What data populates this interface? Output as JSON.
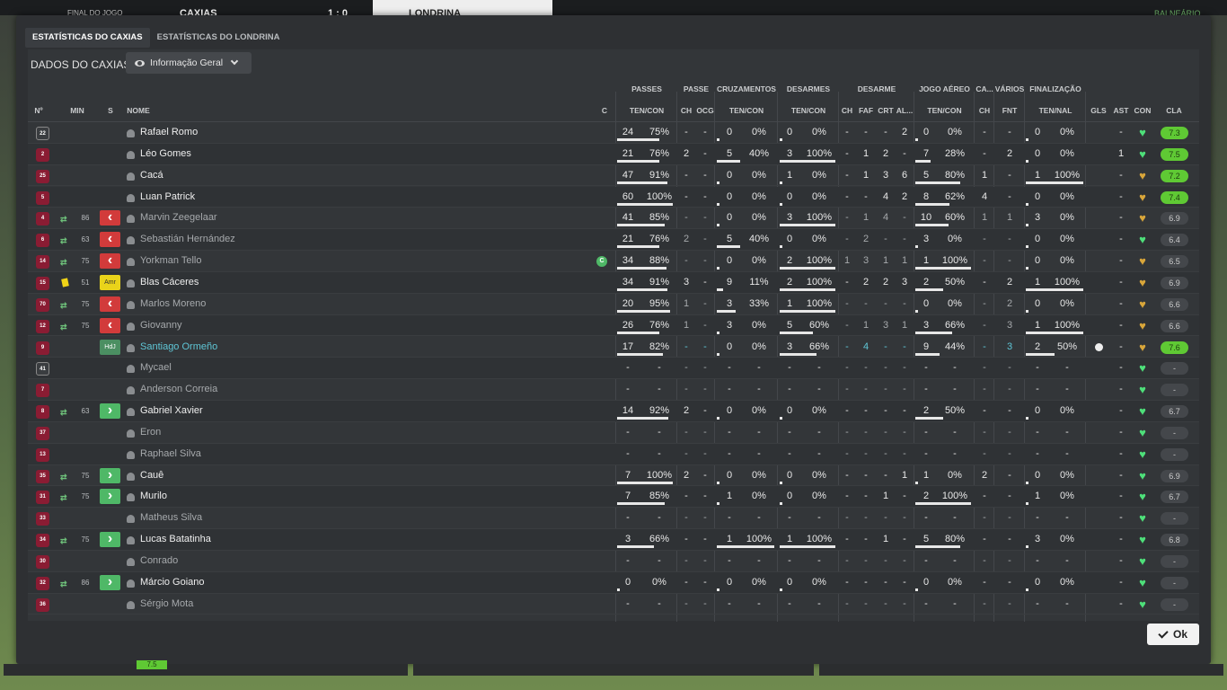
{
  "topbar": {
    "status": "FINAL DO JOGO",
    "home_team": "CAXIAS",
    "score": "1 : 0",
    "away_team": "LONDRINA",
    "right_label": "BALNEÁRIO"
  },
  "tabs": [
    {
      "label": "ESTATÍSTICAS DO CAXIAS",
      "active": true
    },
    {
      "label": "ESTATÍSTICAS DO LONDRINA",
      "active": false
    }
  ],
  "panel": {
    "title": "DADOS DO CAXIAS",
    "view_selector": "Informação Geral"
  },
  "group_headers": [
    "PASSES",
    "PASSE",
    "CRUZAMENTOS",
    "DESARMES",
    "DESARME",
    "JOGO AÉREO",
    "CA...",
    "VÁRIOS",
    "FINALIZAÇÃO"
  ],
  "columns": {
    "num": "Nº",
    "min": "MIN",
    "s": "S",
    "nome": "NOME",
    "c": "C",
    "passes": "TEN/CON",
    "passe_ch": "CH",
    "passe_ocg": "OCG",
    "cruz": "TEN/CON",
    "desarmes": "TEN/CON",
    "des_ch": "CH",
    "des_faf": "FAF",
    "des_crt": "CRT",
    "des_al": "AL...",
    "aereo": "TEN/CON",
    "ca_ch": "CH",
    "fnt": "FNT",
    "final": "TEN/NAL",
    "gls": "GLS",
    "ast": "AST",
    "con": "CON",
    "cla": "CLA"
  },
  "colors": {
    "accent_green": "#5fc934",
    "sub_out": "#d23b3b",
    "sub_in": "#4fb867",
    "highlight_name": "#5fc6d6",
    "shirt": "#8a1c33"
  },
  "players": [
    {
      "num": "22",
      "gk": true,
      "min": "",
      "s": "",
      "nome": "Rafael Romo",
      "dim": false,
      "c": "",
      "pt": "24",
      "pp": "75%",
      "pch": "-",
      "pocg": "-",
      "ct": "0",
      "cp": "0%",
      "dt": "0",
      "dp": "0%",
      "dch": "-",
      "faf": "-",
      "crt": "-",
      "al": "2",
      "at": "0",
      "ap": "0%",
      "cach": "-",
      "fnt": "-",
      "ft": "0",
      "fp": "0%",
      "gls": "",
      "ast": "-",
      "con": "green",
      "cla": "7.3",
      "cla_g": true
    },
    {
      "num": "2",
      "min": "",
      "s": "",
      "nome": "Léo Gomes",
      "c": "",
      "pt": "21",
      "pp": "76%",
      "pch": "2",
      "pocg": "-",
      "ct": "5",
      "cp": "40%",
      "dt": "3",
      "dp": "100%",
      "dch": "-",
      "faf": "1",
      "crt": "2",
      "al": "-",
      "at": "7",
      "ap": "28%",
      "cach": "-",
      "fnt": "2",
      "ft": "0",
      "fp": "0%",
      "gls": "",
      "ast": "1",
      "con": "green",
      "cla": "7.5",
      "cla_g": true
    },
    {
      "num": "25",
      "min": "",
      "s": "",
      "nome": "Cacá",
      "c": "",
      "pt": "47",
      "pp": "91%",
      "pch": "-",
      "pocg": "-",
      "ct": "0",
      "cp": "0%",
      "dt": "1",
      "dp": "0%",
      "dch": "-",
      "faf": "1",
      "crt": "3",
      "al": "6",
      "at": "5",
      "ap": "80%",
      "cach": "1",
      "fnt": "-",
      "ft": "1",
      "fp": "100%",
      "gls": "",
      "ast": "-",
      "con": "gold",
      "cla": "7.2",
      "cla_g": true
    },
    {
      "num": "5",
      "min": "",
      "s": "",
      "nome": "Luan Patrick",
      "c": "",
      "pt": "60",
      "pp": "100%",
      "pch": "-",
      "pocg": "-",
      "ct": "0",
      "cp": "0%",
      "dt": "0",
      "dp": "0%",
      "dch": "-",
      "faf": "-",
      "crt": "4",
      "al": "2",
      "at": "8",
      "ap": "62%",
      "cach": "4",
      "fnt": "-",
      "ft": "0",
      "fp": "0%",
      "gls": "",
      "ast": "-",
      "con": "gold",
      "cla": "7.4",
      "cla_g": true
    },
    {
      "num": "4",
      "min": "86",
      "s": "out",
      "nome": "Marvin Zeegelaar",
      "dim": true,
      "c": "",
      "pt": "41",
      "pp": "85%",
      "pch": "-",
      "pocg": "-",
      "ct": "0",
      "cp": "0%",
      "dt": "3",
      "dp": "100%",
      "dch": "-",
      "faf": "1",
      "crt": "4",
      "al": "-",
      "at": "10",
      "ap": "60%",
      "cach": "1",
      "fnt": "1",
      "ft": "3",
      "fp": "0%",
      "gls": "",
      "ast": "-",
      "con": "gold",
      "cla": "6.9"
    },
    {
      "num": "6",
      "min": "63",
      "s": "out",
      "nome": "Sebastián Hernández",
      "dim": true,
      "c": "",
      "pt": "21",
      "pp": "76%",
      "pch": "2",
      "pocg": "-",
      "ct": "5",
      "cp": "40%",
      "dt": "0",
      "dp": "0%",
      "dch": "-",
      "faf": "2",
      "crt": "-",
      "al": "-",
      "at": "3",
      "ap": "0%",
      "cach": "-",
      "fnt": "-",
      "ft": "0",
      "fp": "0%",
      "gls": "",
      "ast": "-",
      "con": "green",
      "cla": "6.4"
    },
    {
      "num": "14",
      "min": "75",
      "s": "out",
      "nome": "Yorkman Tello",
      "dim": true,
      "c": "C",
      "pt": "34",
      "pp": "88%",
      "pch": "-",
      "pocg": "-",
      "ct": "0",
      "cp": "0%",
      "dt": "2",
      "dp": "100%",
      "dch": "1",
      "faf": "3",
      "crt": "1",
      "al": "1",
      "at": "1",
      "ap": "100%",
      "cach": "-",
      "fnt": "-",
      "ft": "0",
      "fp": "0%",
      "gls": "",
      "ast": "-",
      "con": "gold",
      "cla": "6.5"
    },
    {
      "num": "15",
      "min": "51",
      "s": "amr",
      "s_label": "Amr",
      "card": true,
      "nome": "Blas Cáceres",
      "c": "",
      "pt": "34",
      "pp": "91%",
      "pch": "3",
      "pocg": "-",
      "ct": "9",
      "cp": "11%",
      "dt": "2",
      "dp": "100%",
      "dch": "-",
      "faf": "2",
      "crt": "2",
      "al": "3",
      "at": "2",
      "ap": "50%",
      "cach": "-",
      "fnt": "2",
      "ft": "1",
      "fp": "100%",
      "gls": "",
      "ast": "-",
      "con": "gold",
      "cla": "6.9"
    },
    {
      "num": "70",
      "min": "75",
      "s": "out",
      "nome": "Marlos Moreno",
      "dim": true,
      "c": "",
      "pt": "20",
      "pp": "95%",
      "pch": "1",
      "pocg": "-",
      "ct": "3",
      "cp": "33%",
      "dt": "1",
      "dp": "100%",
      "dch": "-",
      "faf": "-",
      "crt": "-",
      "al": "-",
      "at": "0",
      "ap": "0%",
      "cach": "-",
      "fnt": "2",
      "ft": "0",
      "fp": "0%",
      "gls": "",
      "ast": "-",
      "con": "gold",
      "cla": "6.6"
    },
    {
      "num": "12",
      "min": "75",
      "s": "out",
      "nome": "Giovanny",
      "dim": true,
      "c": "",
      "pt": "26",
      "pp": "76%",
      "pch": "1",
      "pocg": "-",
      "ct": "3",
      "cp": "0%",
      "dt": "5",
      "dp": "60%",
      "dch": "-",
      "faf": "1",
      "crt": "3",
      "al": "1",
      "at": "3",
      "ap": "66%",
      "cach": "-",
      "fnt": "3",
      "ft": "1",
      "fp": "100%",
      "gls": "",
      "ast": "-",
      "con": "gold",
      "cla": "6.6"
    },
    {
      "num": "9",
      "min": "",
      "s": "hdj",
      "s_label": "HdJ",
      "nome": "Santiago Ormeño",
      "hl": true,
      "c": "",
      "pt": "17",
      "pp": "82%",
      "pch": "-",
      "pocg": "-",
      "ct": "0",
      "cp": "0%",
      "dt": "3",
      "dp": "66%",
      "dch": "-",
      "faf": "4",
      "crt": "-",
      "al": "-",
      "at": "9",
      "ap": "44%",
      "cach": "-",
      "fnt": "3",
      "ft": "2",
      "fp": "50%",
      "gls": "ball",
      "ast": "-",
      "con": "gold",
      "cla": "7.6",
      "cla_g": true
    },
    {
      "num": "41",
      "gk": true,
      "min": "",
      "s": "",
      "nome": "Mycael",
      "dim": true,
      "c": "",
      "pt": "-",
      "pp": "-",
      "pch": "-",
      "pocg": "-",
      "ct": "-",
      "cp": "-",
      "dt": "-",
      "dp": "-",
      "dch": "-",
      "faf": "-",
      "crt": "-",
      "al": "-",
      "at": "-",
      "ap": "-",
      "cach": "-",
      "fnt": "-",
      "ft": "-",
      "fp": "-",
      "gls": "",
      "ast": "-",
      "con": "green",
      "cla": "-"
    },
    {
      "num": "7",
      "min": "",
      "s": "",
      "nome": "Anderson Correia",
      "dim": true,
      "c": "",
      "pt": "-",
      "pp": "-",
      "pch": "-",
      "pocg": "-",
      "ct": "-",
      "cp": "-",
      "dt": "-",
      "dp": "-",
      "dch": "-",
      "faf": "-",
      "crt": "-",
      "al": "-",
      "at": "-",
      "ap": "-",
      "cach": "-",
      "fnt": "-",
      "ft": "-",
      "fp": "-",
      "gls": "",
      "ast": "-",
      "con": "green",
      "cla": "-"
    },
    {
      "num": "8",
      "min": "63",
      "s": "in",
      "nome": "Gabriel Xavier",
      "c": "",
      "pt": "14",
      "pp": "92%",
      "pch": "2",
      "pocg": "-",
      "ct": "0",
      "cp": "0%",
      "dt": "0",
      "dp": "0%",
      "dch": "-",
      "faf": "-",
      "crt": "-",
      "al": "-",
      "at": "2",
      "ap": "50%",
      "cach": "-",
      "fnt": "-",
      "ft": "0",
      "fp": "0%",
      "gls": "",
      "ast": "-",
      "con": "green",
      "cla": "6.7"
    },
    {
      "num": "37",
      "min": "",
      "s": "",
      "nome": "Eron",
      "dim": true,
      "c": "",
      "pt": "-",
      "pp": "-",
      "pch": "-",
      "pocg": "-",
      "ct": "-",
      "cp": "-",
      "dt": "-",
      "dp": "-",
      "dch": "-",
      "faf": "-",
      "crt": "-",
      "al": "-",
      "at": "-",
      "ap": "-",
      "cach": "-",
      "fnt": "-",
      "ft": "-",
      "fp": "-",
      "gls": "",
      "ast": "-",
      "con": "green",
      "cla": "-"
    },
    {
      "num": "13",
      "min": "",
      "s": "",
      "nome": "Raphael Silva",
      "dim": true,
      "c": "",
      "pt": "-",
      "pp": "-",
      "pch": "-",
      "pocg": "-",
      "ct": "-",
      "cp": "-",
      "dt": "-",
      "dp": "-",
      "dch": "-",
      "faf": "-",
      "crt": "-",
      "al": "-",
      "at": "-",
      "ap": "-",
      "cach": "-",
      "fnt": "-",
      "ft": "-",
      "fp": "-",
      "gls": "",
      "ast": "-",
      "con": "green",
      "cla": "-"
    },
    {
      "num": "35",
      "min": "75",
      "s": "in",
      "nome": "Cauê",
      "c": "",
      "pt": "7",
      "pp": "100%",
      "pch": "2",
      "pocg": "-",
      "ct": "0",
      "cp": "0%",
      "dt": "0",
      "dp": "0%",
      "dch": "-",
      "faf": "-",
      "crt": "-",
      "al": "1",
      "at": "1",
      "ap": "0%",
      "cach": "2",
      "fnt": "-",
      "ft": "0",
      "fp": "0%",
      "gls": "",
      "ast": "-",
      "con": "green",
      "cla": "6.9"
    },
    {
      "num": "31",
      "min": "75",
      "s": "in",
      "nome": "Murilo",
      "c": "",
      "pt": "7",
      "pp": "85%",
      "pch": "-",
      "pocg": "-",
      "ct": "1",
      "cp": "0%",
      "dt": "0",
      "dp": "0%",
      "dch": "-",
      "faf": "-",
      "crt": "1",
      "al": "-",
      "at": "2",
      "ap": "100%",
      "cach": "-",
      "fnt": "-",
      "ft": "1",
      "fp": "0%",
      "gls": "",
      "ast": "-",
      "con": "green",
      "cla": "6.7"
    },
    {
      "num": "33",
      "min": "",
      "s": "",
      "nome": "Matheus Silva",
      "dim": true,
      "c": "",
      "pt": "-",
      "pp": "-",
      "pch": "-",
      "pocg": "-",
      "ct": "-",
      "cp": "-",
      "dt": "-",
      "dp": "-",
      "dch": "-",
      "faf": "-",
      "crt": "-",
      "al": "-",
      "at": "-",
      "ap": "-",
      "cach": "-",
      "fnt": "-",
      "ft": "-",
      "fp": "-",
      "gls": "",
      "ast": "-",
      "con": "green",
      "cla": "-"
    },
    {
      "num": "34",
      "min": "75",
      "s": "in",
      "nome": "Lucas Batatinha",
      "c": "",
      "pt": "3",
      "pp": "66%",
      "pch": "-",
      "pocg": "-",
      "ct": "1",
      "cp": "100%",
      "dt": "1",
      "dp": "100%",
      "dch": "-",
      "faf": "-",
      "crt": "1",
      "al": "-",
      "at": "5",
      "ap": "80%",
      "cach": "-",
      "fnt": "-",
      "ft": "3",
      "fp": "0%",
      "gls": "",
      "ast": "-",
      "con": "green",
      "cla": "6.8"
    },
    {
      "num": "30",
      "min": "",
      "s": "",
      "nome": "Conrado",
      "dim": true,
      "c": "",
      "pt": "-",
      "pp": "-",
      "pch": "-",
      "pocg": "-",
      "ct": "-",
      "cp": "-",
      "dt": "-",
      "dp": "-",
      "dch": "-",
      "faf": "-",
      "crt": "-",
      "al": "-",
      "at": "-",
      "ap": "-",
      "cach": "-",
      "fnt": "-",
      "ft": "-",
      "fp": "-",
      "gls": "",
      "ast": "-",
      "con": "green",
      "cla": "-"
    },
    {
      "num": "32",
      "min": "86",
      "s": "in",
      "nome": "Márcio Goiano",
      "c": "",
      "pt": "0",
      "pp": "0%",
      "pch": "-",
      "pocg": "-",
      "ct": "0",
      "cp": "0%",
      "dt": "0",
      "dp": "0%",
      "dch": "-",
      "faf": "-",
      "crt": "-",
      "al": "-",
      "at": "0",
      "ap": "0%",
      "cach": "-",
      "fnt": "-",
      "ft": "0",
      "fp": "0%",
      "gls": "",
      "ast": "-",
      "con": "green",
      "cla": "-"
    },
    {
      "num": "36",
      "min": "",
      "s": "",
      "nome": "Sérgio Mota",
      "dim": true,
      "c": "",
      "pt": "-",
      "pp": "-",
      "pch": "-",
      "pocg": "-",
      "ct": "-",
      "cp": "-",
      "dt": "-",
      "dp": "-",
      "dch": "-",
      "faf": "-",
      "crt": "-",
      "al": "-",
      "at": "-",
      "ap": "-",
      "cach": "-",
      "fnt": "-",
      "ft": "-",
      "fp": "-",
      "gls": "",
      "ast": "-",
      "con": "green",
      "cla": "-"
    }
  ],
  "ok_button": "Ok",
  "bottom_rating": "7.5"
}
